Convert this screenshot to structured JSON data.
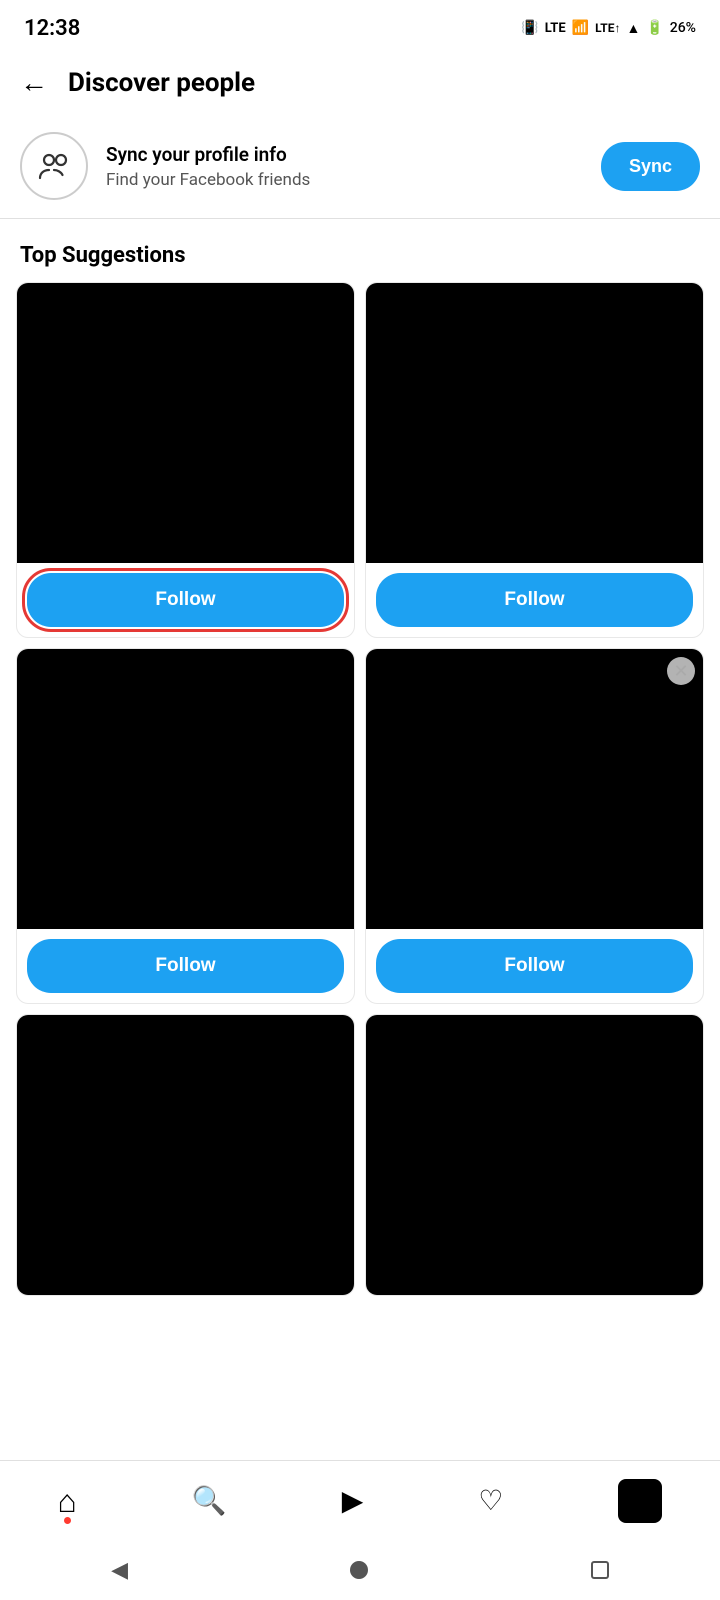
{
  "statusBar": {
    "time": "12:38",
    "battery": "26%"
  },
  "header": {
    "backLabel": "←",
    "title": "Discover people"
  },
  "syncBanner": {
    "title": "Sync your profile info",
    "subtitle": "Find your Facebook friends",
    "buttonLabel": "Sync"
  },
  "sectionTitle": "Top Suggestions",
  "cards": [
    {
      "id": 1,
      "highlighted": true,
      "hasClose": false
    },
    {
      "id": 2,
      "highlighted": false,
      "hasClose": false
    },
    {
      "id": 3,
      "highlighted": false,
      "hasClose": false
    },
    {
      "id": 4,
      "highlighted": false,
      "hasClose": true
    },
    {
      "id": 5,
      "highlighted": false,
      "hasClose": false
    },
    {
      "id": 6,
      "highlighted": false,
      "hasClose": false
    }
  ],
  "followLabel": "Follow",
  "nav": {
    "items": [
      {
        "name": "home",
        "icon": "⌂",
        "hasDot": true
      },
      {
        "name": "search",
        "icon": "🔍",
        "hasDot": false
      },
      {
        "name": "reels",
        "icon": "▶",
        "hasDot": false
      },
      {
        "name": "activity",
        "icon": "♡",
        "hasDot": false
      }
    ]
  }
}
